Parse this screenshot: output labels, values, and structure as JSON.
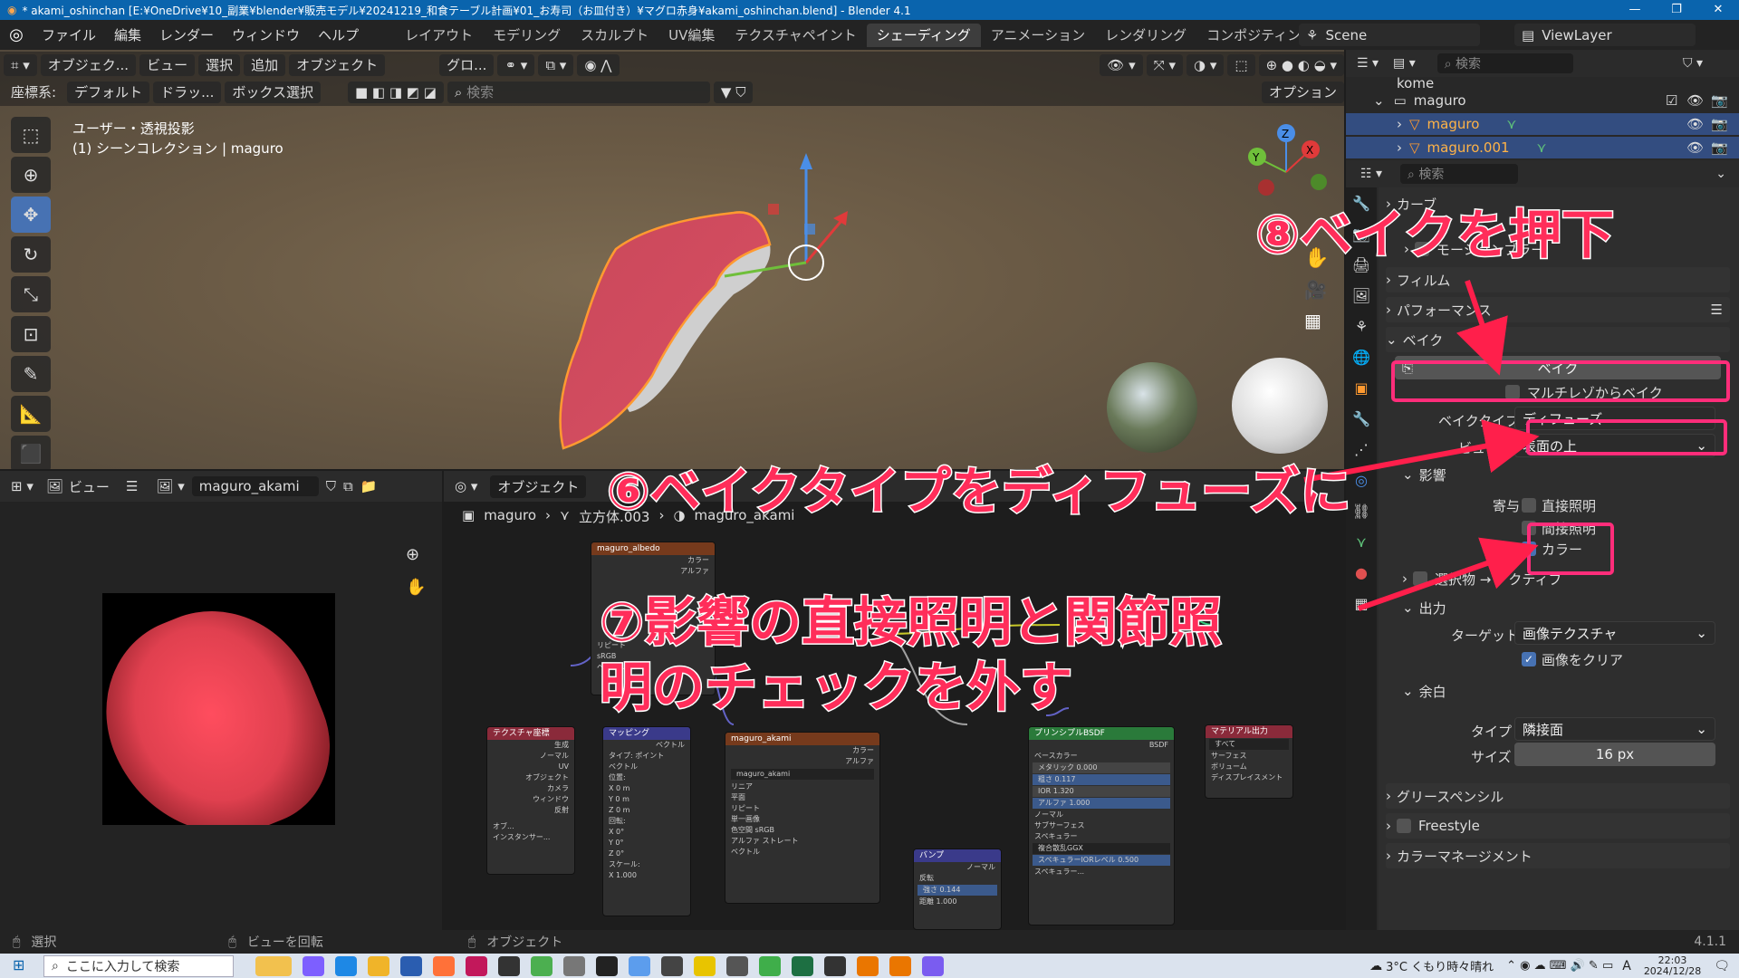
{
  "titlebar": {
    "text": "* akami_oshinchan [E:¥OneDrive¥10_副業¥blender¥販売モデル¥20241219_和食テーブル計画¥01_お寿司（お皿付き）¥マグロ赤身¥akami_oshinchan.blend] - Blender 4.1",
    "minimize": "—",
    "maximize": "❐",
    "close": "✕"
  },
  "menu": {
    "items": [
      "ファイル",
      "編集",
      "レンダー",
      "ウィンドウ",
      "ヘルプ"
    ],
    "workspaces": [
      "レイアウト",
      "モデリング",
      "スカルプト",
      "UV編集",
      "テクスチャペイント",
      "シェーディング",
      "アニメーション",
      "レンダリング",
      "コンポジティング"
    ],
    "active_workspace": "シェーディング",
    "scene": "Scene",
    "view_layer": "ViewLayer"
  },
  "viewport": {
    "mode": "オブジェク...",
    "menus": [
      "ビュー",
      "選択",
      "追加",
      "オブジェクト"
    ],
    "transform_orientation": "グロ...",
    "coord_label": "座標系:",
    "coord_value": "デフォルト",
    "drag_label": "ドラッ...",
    "select_mode": "ボックス選択",
    "search_placeholder": "検索",
    "options": "オプション",
    "info_line1": "ユーザー・透視投影",
    "info_line2": "(1) シーンコレクション | maguro"
  },
  "outliner": {
    "search_placeholder": "検索",
    "rows": [
      {
        "name": "kome",
        "selected": false
      },
      {
        "name": "maguro",
        "selected": false
      },
      {
        "name": "maguro",
        "selected": true
      },
      {
        "name": "maguro.001",
        "selected": true
      }
    ]
  },
  "properties": {
    "search_placeholder": "検索",
    "panels": {
      "curve": "カーブ",
      "motion_blur": "モーションブラー",
      "film": "フィルム",
      "performance": "パフォーマンス",
      "bake": "ベイク",
      "grease_pencil": "グリースペンシル",
      "freestyle": "Freestyle",
      "color_mgmt": "カラーマネージメント"
    },
    "bake_button": "ベイク",
    "multires": "マルチレゾからベイク",
    "bake_type_label": "ベイクタイプ",
    "bake_type_value": "ディフューズ",
    "view_from_label": "ビュー元",
    "view_from_value": "表面の上",
    "influence": "影響",
    "contrib_label": "寄与",
    "direct": "直接照明",
    "indirect": "間接照明",
    "color": "カラー",
    "selected_to_active": "選択物 → アクティブ",
    "output": "出力",
    "target_label": "ターゲット",
    "target_value": "画像テクスチャ",
    "clear_image": "画像をクリア",
    "margin": "余白",
    "margin_type_label": "タイプ",
    "margin_type_value": "隣接面",
    "margin_size_label": "サイズ",
    "margin_size_value": "16 px"
  },
  "image_editor": {
    "view": "ビュー",
    "image_name": "maguro_akami"
  },
  "node_editor": {
    "mode": "オブジェクト",
    "breadcrumb": [
      "maguro",
      "立方体.003",
      "maguro_akami"
    ],
    "nodes": {
      "albedo": {
        "title": "maguro_albedo",
        "rows": [
          "カラー",
          "アルファ",
          "リピート",
          "sRGB",
          "ベクトル"
        ]
      },
      "texcoord": {
        "title": "テクスチャ座標",
        "rows": [
          "生成",
          "ノーマル",
          "UV",
          "オブジェクト",
          "カメラ",
          "ウィンドウ",
          "反射",
          "オブ...",
          "インスタンサー..."
        ]
      },
      "mapping": {
        "title": "マッピング",
        "rows": [
          "ベクトル",
          "タイプ: ポイント",
          "ベクトル",
          "位置:",
          "X 0 m",
          "Y 0 m",
          "Z 0 m",
          "回転:",
          "X 0°",
          "Y 0°",
          "Z 0°",
          "スケール:",
          "X 1.000"
        ]
      },
      "akami": {
        "title": "maguro_akami",
        "rows": [
          "カラー",
          "アルファ",
          "maguro_akami",
          "リニア",
          "平面",
          "リピート",
          "単一画像",
          "色空間 sRGB",
          "アルファ ストレート",
          "ベクトル"
        ]
      },
      "bump": {
        "title": "バンプ",
        "rows": [
          "ノーマル",
          "反転",
          "強さ 0.144",
          "距離 1.000"
        ]
      },
      "bsdf": {
        "title": "プリンシプルBSDF",
        "rows": [
          "BSDF",
          "ベースカラー",
          "メタリック 0.000",
          "粗さ 0.117",
          "IOR 1.320",
          "アルファ 1.000",
          "ノーマル",
          "サブサーフェス",
          "スペキュラー",
          "複合散乱GGX",
          "スペキュラーIORレベル 0.500",
          "スペキュラー..."
        ]
      },
      "output": {
        "title": "マテリアル出力",
        "rows": [
          "すべて",
          "サーフェス",
          "ボリューム",
          "ディスプレイスメント"
        ]
      }
    }
  },
  "statusbar": {
    "select": "選択",
    "rotate": "ビューを回転",
    "object": "オブジェクト",
    "version": "4.1.1"
  },
  "taskbar": {
    "search_placeholder": "ここに入力して検索",
    "weather": "3°C くもり時々晴れ",
    "time": "22:03",
    "date": "2024/12/28",
    "ime": "A"
  },
  "annotations": {
    "step6": "⑥ベイクタイプをディフューズに",
    "step7_line1": "⑦影響の直接照明と関節照",
    "step7_line2": "明のチェックを外す",
    "step8": "⑧ベイクを押下"
  },
  "colors": {
    "accent": "#4772b3",
    "annotation": "#ff2d5a",
    "title_bar": "#0a64ad"
  }
}
